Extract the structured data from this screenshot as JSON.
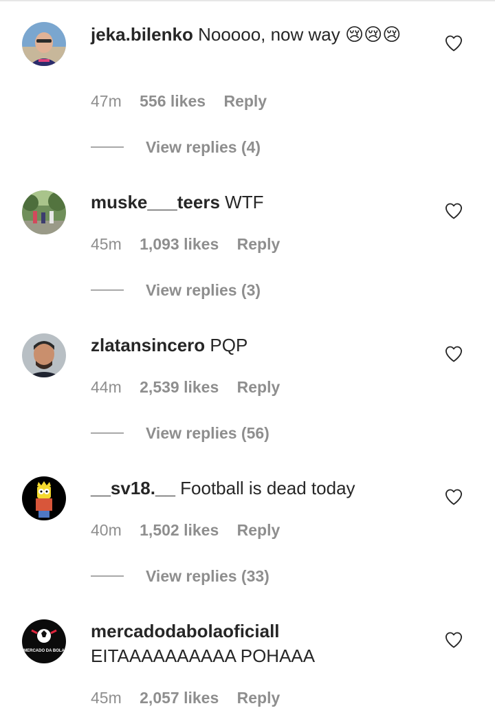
{
  "comments": [
    {
      "username": "jeka.bilenko",
      "text": "Nooooo, now way 😢😢😢",
      "time": "47m",
      "likes": "556 likes",
      "reply": "Reply",
      "view_replies": "View replies (4)"
    },
    {
      "username": "muske___teers",
      "text": "WTF",
      "time": "45m",
      "likes": "1,093 likes",
      "reply": "Reply",
      "view_replies": "View replies (3)"
    },
    {
      "username": "zlatansincero",
      "text": "PQP",
      "time": "44m",
      "likes": "2,539 likes",
      "reply": "Reply",
      "view_replies": "View replies (56)"
    },
    {
      "username": "__sv18.__",
      "text": "Football is dead today",
      "time": "40m",
      "likes": "1,502 likes",
      "reply": "Reply",
      "view_replies": "View replies (33)"
    },
    {
      "username": "mercadodabolaoficiall",
      "text": "EITAAAAAAAAAA POHAAA",
      "time": "45m",
      "likes": "2,057 likes",
      "reply": "Reply"
    }
  ],
  "avatar5_text": "MERCADO DA BOLA",
  "colors": {
    "text": "#262626",
    "secondary": "#8e8e8e",
    "background": "#ffffff"
  },
  "icons": {
    "like": "heart-outline-icon"
  }
}
